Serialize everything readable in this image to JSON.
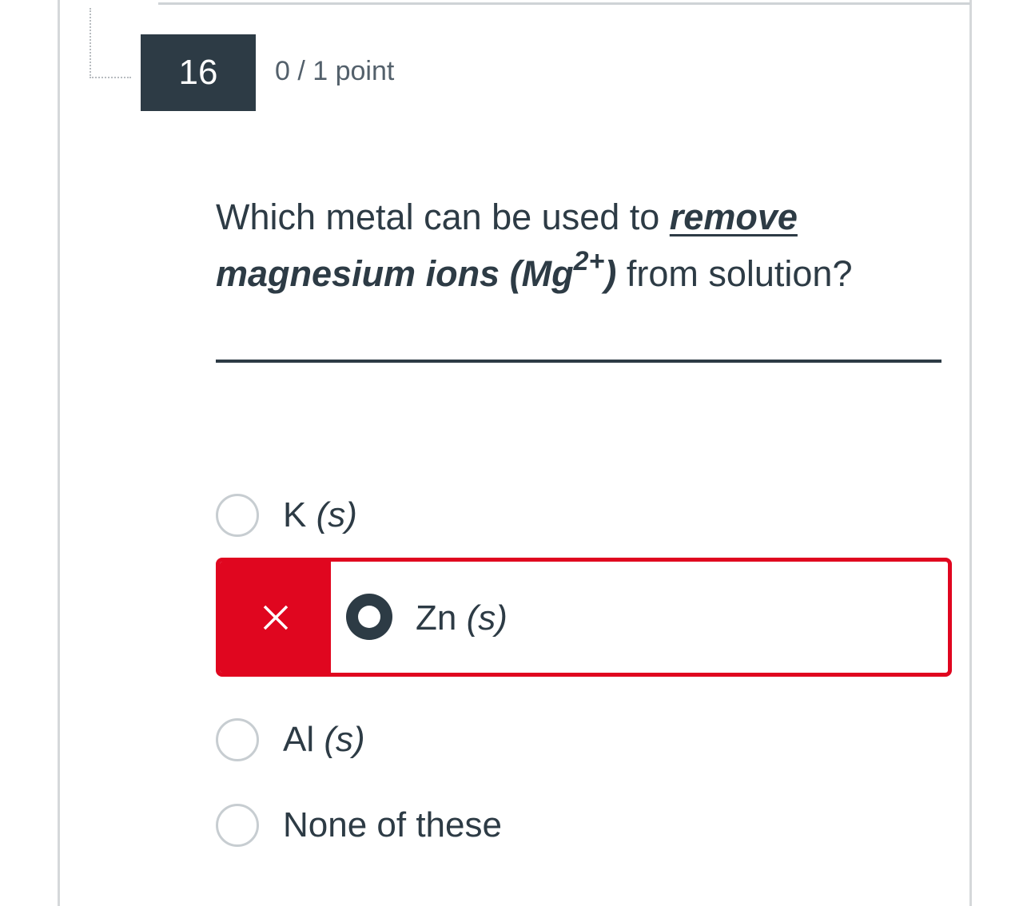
{
  "question": {
    "number": "16",
    "points": "0 / 1 point",
    "text_part1": "Which metal can be used to ",
    "text_emphasis1": "remove",
    "text_emphasis2": "magnesium ions",
    "text_formula": "(Mg",
    "text_superscript": "2+",
    "text_formula_close": ")",
    "text_part2": " from solution?"
  },
  "options": [
    {
      "label": "K",
      "state": "(s)",
      "selected": false
    },
    {
      "label": "Zn",
      "state": "(s)",
      "selected": true,
      "result": "incorrect"
    },
    {
      "label": "Al",
      "state": "(s)",
      "selected": false
    },
    {
      "label": "None of these",
      "state": "",
      "selected": false
    }
  ],
  "icons": {
    "incorrect": "close-icon"
  },
  "colors": {
    "question_number_bg": "#2d3b45",
    "incorrect": "#e0061f",
    "text": "#2d3b45"
  }
}
